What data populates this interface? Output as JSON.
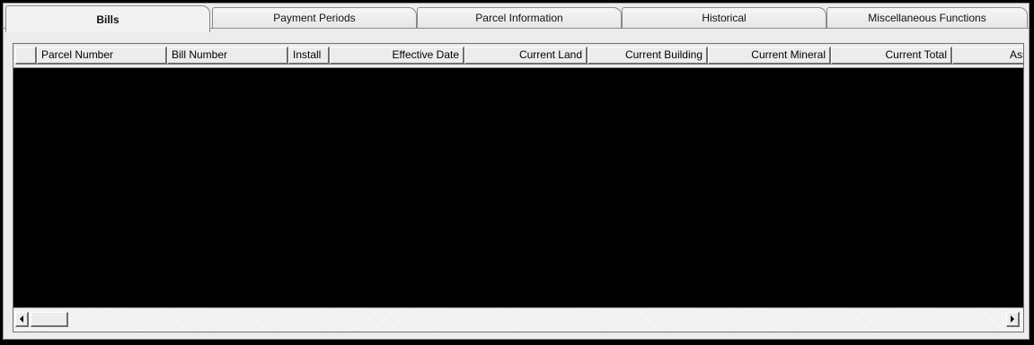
{
  "tabs": [
    {
      "label": "Bills",
      "active": true
    },
    {
      "label": "Payment Periods",
      "active": false
    },
    {
      "label": "Parcel Information",
      "active": false
    },
    {
      "label": "Historical",
      "active": false
    },
    {
      "label": "Miscellaneous Functions",
      "active": false
    }
  ],
  "table": {
    "columns": [
      {
        "label": ""
      },
      {
        "label": "Parcel Number"
      },
      {
        "label": "Bill Number"
      },
      {
        "label": "Install"
      },
      {
        "label": "Effective Date"
      },
      {
        "label": "Current Land"
      },
      {
        "label": "Current Building"
      },
      {
        "label": "Current Mineral"
      },
      {
        "label": "Current Total"
      },
      {
        "label": "Ass"
      }
    ],
    "rows": []
  },
  "colors": {
    "background": "#000000",
    "panel": "#ececec",
    "border": "#6f6f6f"
  },
  "icons": {
    "scroll_left": "arrow-left-icon",
    "scroll_right": "arrow-right-icon"
  }
}
